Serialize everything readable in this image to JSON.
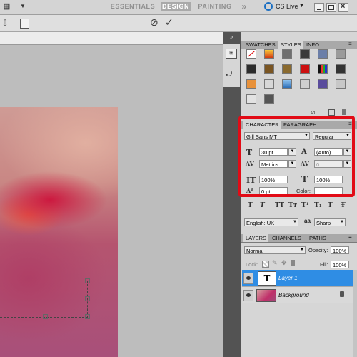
{
  "workspace": {
    "items": [
      "ESSENTIALS",
      "DESIGN",
      "PAINTING"
    ],
    "active": "DESIGN",
    "more": "»",
    "cs_live": "CS Live"
  },
  "options_bar": {
    "cancel_icon": "⊘",
    "commit_icon": "✓"
  },
  "swatches_panel": {
    "tabs": [
      "SWATCHES",
      "STYLES",
      "INFO"
    ],
    "active_tab": "STYLES"
  },
  "character": {
    "tabs": [
      "CHARACTER",
      "PARAGRAPH"
    ],
    "active_tab": "CHARACTER",
    "font_family": "Gill Sans MT",
    "font_style": "Regular",
    "font_size": "30 pt",
    "leading": "(Auto)",
    "kerning": "Metrics",
    "tracking": "0",
    "vertical_scale": "100%",
    "horizontal_scale": "100%",
    "baseline_shift": "0 pt",
    "color_label": "Color:",
    "language": "English: UK",
    "aa_label": "aa",
    "antialias": "Sharp",
    "style_buttons": [
      "T",
      "T",
      "TT",
      "Tт",
      "T¹",
      "T₁",
      "T",
      "Ŧ"
    ]
  },
  "layers": {
    "tabs": [
      "LAYERS",
      "CHANNELS",
      "PATHS"
    ],
    "active_tab": "LAYERS",
    "blend_mode": "Normal",
    "opacity_label": "Opacity:",
    "opacity": "100%",
    "lock_label": "Lock:",
    "fill_label": "Fill:",
    "fill": "100%",
    "items": [
      {
        "name": "Layer 1",
        "thumb": "T",
        "selected": true
      },
      {
        "name": "Background",
        "thumb": "",
        "selected": false
      }
    ]
  },
  "colors": {
    "highlight": "#e20b16",
    "selection": "#2f8de4"
  }
}
